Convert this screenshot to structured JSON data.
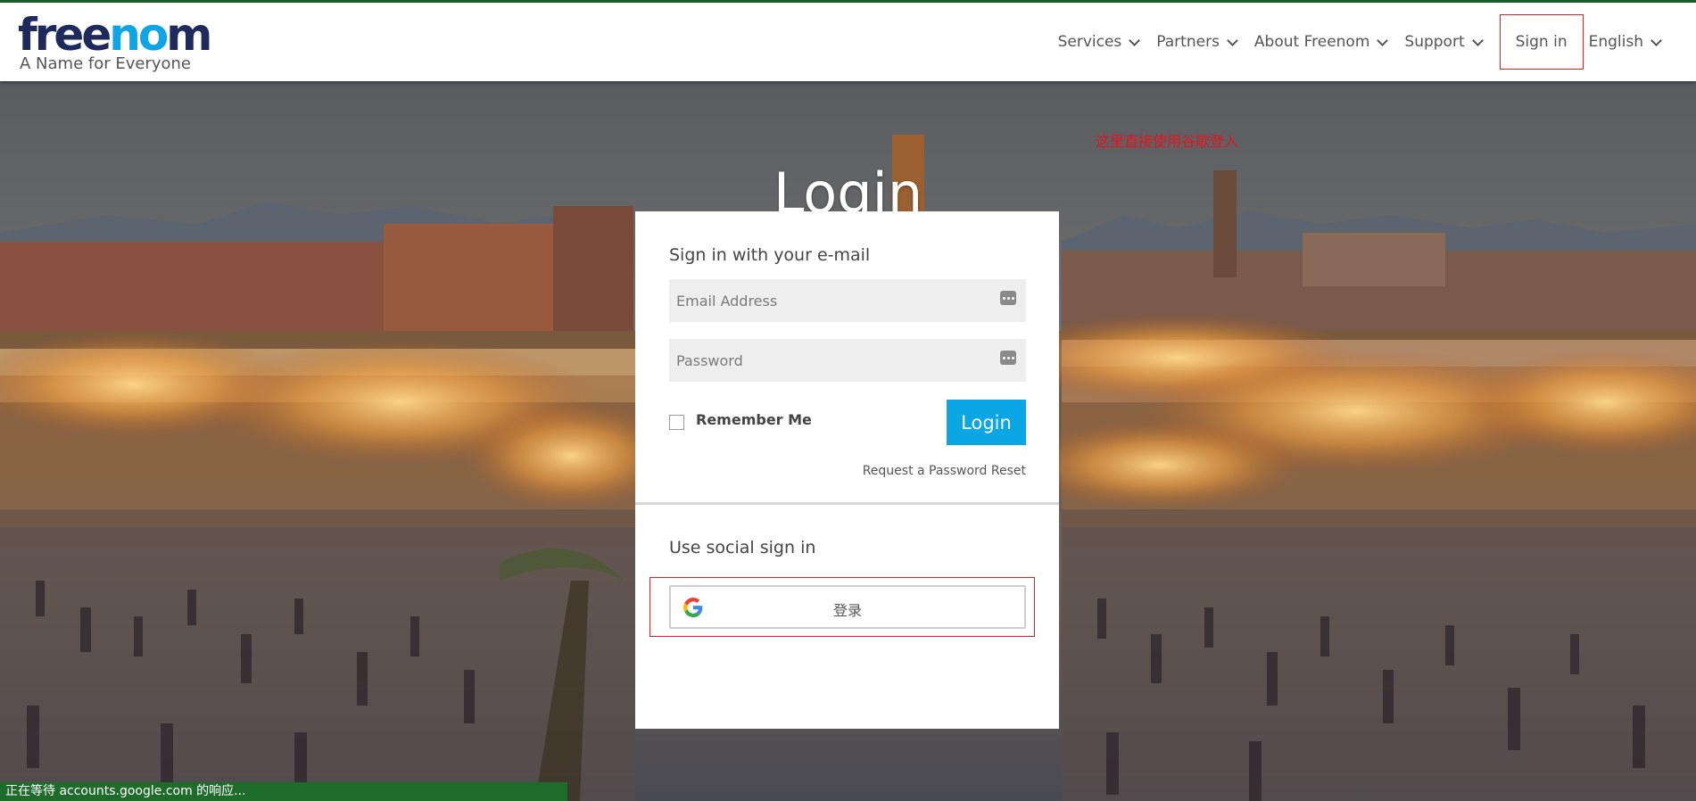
{
  "brand": {
    "logo_text": "freenom",
    "tagline": "A Name for Everyone"
  },
  "nav": {
    "items": [
      {
        "label": "Services"
      },
      {
        "label": "Partners"
      },
      {
        "label": "About Freenom"
      },
      {
        "label": "Support"
      }
    ],
    "signin_label": "Sign in",
    "language_label": "English"
  },
  "annotation": "这里直接使用谷歌登入",
  "page": {
    "title": "Login"
  },
  "login_form": {
    "section_title": "Sign in with your e-mail",
    "email_placeholder": "Email Address",
    "password_placeholder": "Password",
    "remember_label": "Remember Me",
    "login_button": "Login",
    "reset_link": "Request a Password Reset"
  },
  "social": {
    "section_title": "Use social sign in",
    "google_button_label": "登录"
  },
  "status_bar": {
    "text": "正在等待 accounts.google.com 的响应..."
  },
  "colors": {
    "brand_dark": "#1e2a5c",
    "brand_accent": "#0ea5e6",
    "login_button": "#0ba6e4",
    "highlight_red": "#e02020",
    "status_bar": "#1f6b2c"
  }
}
